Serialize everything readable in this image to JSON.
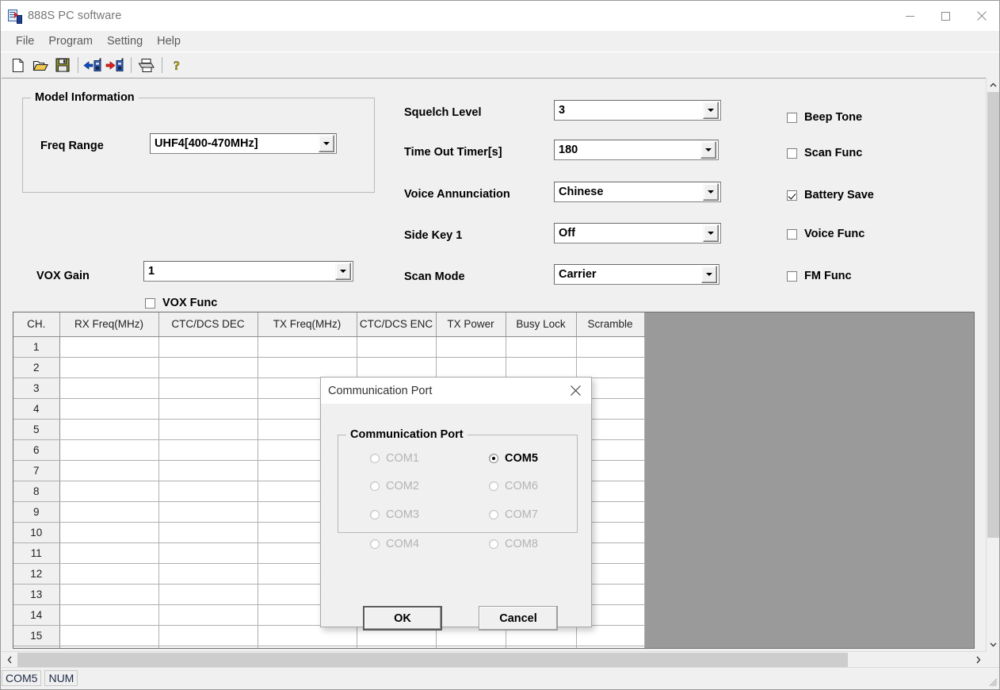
{
  "window": {
    "title": "888S PC software",
    "icon": "radio-program-icon",
    "controls": {
      "minimize": "minimize-icon",
      "maximize": "maximize-icon",
      "close": "close-icon"
    }
  },
  "menubar": {
    "items": [
      {
        "label": "File"
      },
      {
        "label": "Program"
      },
      {
        "label": "Setting"
      },
      {
        "label": "Help"
      }
    ]
  },
  "toolbar": {
    "buttons": [
      {
        "name": "new-file-icon",
        "tip": "New"
      },
      {
        "name": "open-file-icon",
        "tip": "Open"
      },
      {
        "name": "save-file-icon",
        "tip": "Save"
      },
      {
        "name": "read-from-radio-icon",
        "tip": "Read from radio"
      },
      {
        "name": "write-to-radio-icon",
        "tip": "Write to radio"
      },
      {
        "name": "print-icon",
        "tip": "Print"
      },
      {
        "name": "help-icon",
        "tip": "About"
      }
    ]
  },
  "settings": {
    "model_group": {
      "title": "Model Information"
    },
    "freq_range": {
      "label": "Freq Range",
      "value": "UHF4[400-470MHz]"
    },
    "vox_func": {
      "label": "VOX Func",
      "checked": false
    },
    "vox_gain": {
      "label": "VOX Gain",
      "value": "1"
    },
    "fields": [
      {
        "label": "Squelch Level",
        "value": "3"
      },
      {
        "label": "Time Out Timer[s]",
        "value": "180"
      },
      {
        "label": "Voice Annunciation",
        "value": "Chinese"
      },
      {
        "label": "Side Key 1",
        "value": "Off"
      },
      {
        "label": "Scan Mode",
        "value": "Carrier"
      }
    ],
    "checkboxes": [
      {
        "label": "Beep Tone",
        "checked": false
      },
      {
        "label": "Scan Func",
        "checked": false
      },
      {
        "label": "Battery Save",
        "checked": true
      },
      {
        "label": "Voice Func",
        "checked": false
      },
      {
        "label": "FM Func",
        "checked": false
      }
    ]
  },
  "grid": {
    "columns": [
      "CH.",
      "RX Freq(MHz)",
      "CTC/DCS DEC",
      "TX Freq(MHz)",
      "CTC/DCS ENC",
      "TX Power",
      "Busy Lock",
      "Scramble"
    ],
    "rows": [
      {
        "ch": "1",
        "cells": [
          "",
          "",
          "",
          "",
          "",
          "",
          ""
        ]
      },
      {
        "ch": "2",
        "cells": [
          "",
          "",
          "",
          "",
          "",
          "",
          ""
        ]
      },
      {
        "ch": "3",
        "cells": [
          "",
          "",
          "",
          "",
          "",
          "",
          ""
        ]
      },
      {
        "ch": "4",
        "cells": [
          "",
          "",
          "",
          "",
          "",
          "",
          ""
        ]
      },
      {
        "ch": "5",
        "cells": [
          "",
          "",
          "",
          "",
          "",
          "",
          ""
        ]
      },
      {
        "ch": "6",
        "cells": [
          "",
          "",
          "",
          "",
          "",
          "",
          ""
        ]
      },
      {
        "ch": "7",
        "cells": [
          "",
          "",
          "",
          "",
          "",
          "",
          ""
        ]
      },
      {
        "ch": "8",
        "cells": [
          "",
          "",
          "",
          "",
          "",
          "",
          ""
        ]
      },
      {
        "ch": "9",
        "cells": [
          "",
          "",
          "",
          "",
          "",
          "",
          ""
        ]
      },
      {
        "ch": "10",
        "cells": [
          "",
          "",
          "",
          "",
          "",
          "",
          ""
        ]
      },
      {
        "ch": "11",
        "cells": [
          "",
          "",
          "",
          "",
          "",
          "",
          ""
        ]
      },
      {
        "ch": "12",
        "cells": [
          "",
          "",
          "",
          "",
          "",
          "",
          ""
        ]
      },
      {
        "ch": "13",
        "cells": [
          "",
          "",
          "",
          "",
          "",
          "",
          ""
        ]
      },
      {
        "ch": "14",
        "cells": [
          "",
          "",
          "",
          "",
          "",
          "",
          ""
        ]
      },
      {
        "ch": "15",
        "cells": [
          "",
          "",
          "",
          "",
          "",
          "",
          ""
        ]
      },
      {
        "ch": "",
        "cells": [
          "",
          "",
          "",
          "",
          "",
          "",
          ""
        ]
      }
    ]
  },
  "dialog": {
    "title": "Communication Port",
    "group_title": "Communication Port",
    "ports_left": [
      {
        "label": "COM1",
        "selected": false,
        "disabled": true
      },
      {
        "label": "COM2",
        "selected": false,
        "disabled": true
      },
      {
        "label": "COM3",
        "selected": false,
        "disabled": true
      },
      {
        "label": "COM4",
        "selected": false,
        "disabled": true
      }
    ],
    "ports_right": [
      {
        "label": "COM5",
        "selected": true,
        "disabled": false
      },
      {
        "label": "COM6",
        "selected": false,
        "disabled": true
      },
      {
        "label": "COM7",
        "selected": false,
        "disabled": true
      },
      {
        "label": "COM8",
        "selected": false,
        "disabled": true
      }
    ],
    "ok_label": "OK",
    "cancel_label": "Cancel",
    "close_icon": "close-icon"
  },
  "statusbar": {
    "port": "COM5",
    "num": "NUM"
  },
  "colors": {
    "window_bg": "#f0f0f0",
    "grid_backdrop": "#9a9a9a",
    "scroll_thumb": "#cdcdcd",
    "title_text": "#777777",
    "menu_text": "#5a5a5a"
  }
}
